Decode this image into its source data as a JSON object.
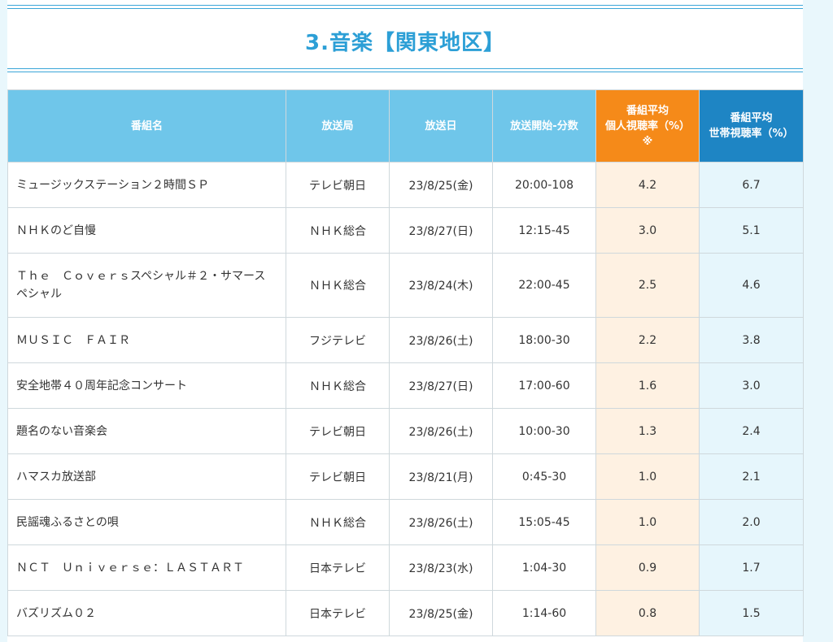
{
  "section": {
    "title": "3.音楽【関東地区】"
  },
  "table": {
    "headers": {
      "program": "番組名",
      "station": "放送局",
      "date": "放送日",
      "start": "放送開始-分数",
      "individual_line1": "番組平均",
      "individual_line2": "個人視聴率（%）",
      "individual_note": "※",
      "household_line1": "番組平均",
      "household_line2": "世帯視聴率（%）"
    },
    "rows": [
      {
        "program": "ミュージックステーション２時間ＳＰ",
        "station": "テレビ朝日",
        "date": "23/8/25(金)",
        "start": "20:00-108",
        "individual": "4.2",
        "household": "6.7"
      },
      {
        "program": "ＮＨＫのど自慢",
        "station": "ＮＨＫ総合",
        "date": "23/8/27(日)",
        "start": "12:15-45",
        "individual": "3.0",
        "household": "5.1"
      },
      {
        "program": "Ｔｈｅ　Ｃｏｖｅｒｓスペシャル＃２・サマースペシャル",
        "station": "ＮＨＫ総合",
        "date": "23/8/24(木)",
        "start": "22:00-45",
        "individual": "2.5",
        "household": "4.6"
      },
      {
        "program": "ＭＵＳＩＣ　ＦＡＩＲ",
        "station": "フジテレビ",
        "date": "23/8/26(土)",
        "start": "18:00-30",
        "individual": "2.2",
        "household": "3.8"
      },
      {
        "program": "安全地帯４０周年記念コンサート",
        "station": "ＮＨＫ総合",
        "date": "23/8/27(日)",
        "start": "17:00-60",
        "individual": "1.6",
        "household": "3.0"
      },
      {
        "program": "題名のない音楽会",
        "station": "テレビ朝日",
        "date": "23/8/26(土)",
        "start": "10:00-30",
        "individual": "1.3",
        "household": "2.4"
      },
      {
        "program": "ハマスカ放送部",
        "station": "テレビ朝日",
        "date": "23/8/21(月)",
        "start": "0:45-30",
        "individual": "1.0",
        "household": "2.1"
      },
      {
        "program": "民謡魂ふるさとの唄",
        "station": "ＮＨＫ総合",
        "date": "23/8/26(土)",
        "start": "15:05-45",
        "individual": "1.0",
        "household": "2.0"
      },
      {
        "program": "ＮＣＴ　Ｕｎｉｖｅｒｓｅ：ＬＡＳＴＡＲＴ",
        "station": "日本テレビ",
        "date": "23/8/23(水)",
        "start": "1:04-30",
        "individual": "0.9",
        "household": "1.7"
      },
      {
        "program": "バズリズム０２",
        "station": "日本テレビ",
        "date": "23/8/25(金)",
        "start": "1:14-60",
        "individual": "0.8",
        "household": "1.5"
      }
    ]
  },
  "colors": {
    "title": "#2c9fd6",
    "header_bg": "#6fc6ea",
    "individual_header_bg": "#f58a19",
    "household_header_bg": "#1e85c4",
    "individual_cell_bg": "#fef1e2",
    "household_cell_bg": "#e6f6fc",
    "page_bg": "#e9f7fc"
  }
}
